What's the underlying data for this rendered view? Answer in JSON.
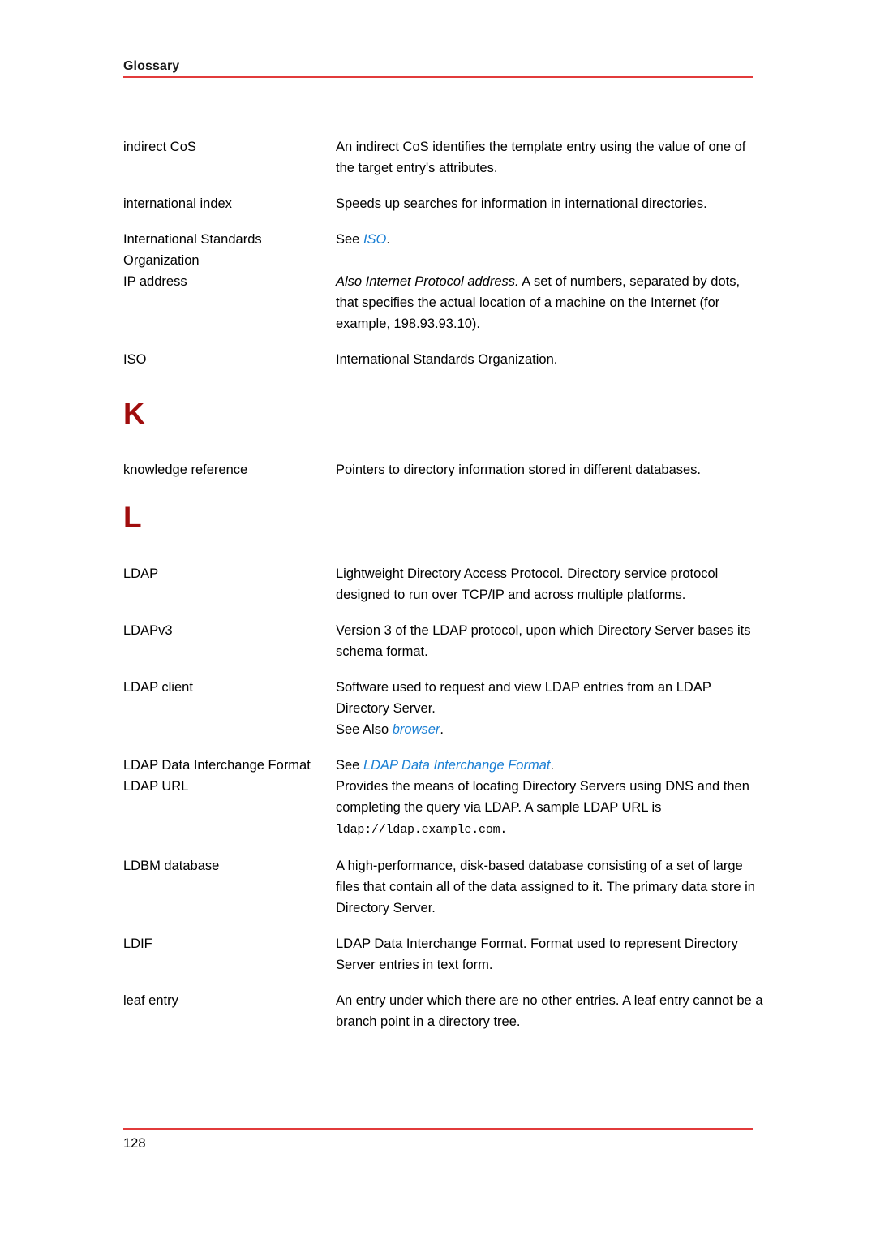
{
  "header": {
    "title": "Glossary",
    "rule_color": "#e23b3b"
  },
  "colors": {
    "link": "#1a7fd4",
    "letter_heading": "#a00d0d",
    "rule": "#e23b3b",
    "text": "#000000"
  },
  "entries": [
    {
      "term": "indirect CoS",
      "definition_plain": "An indirect CoS identifies the template entry using the value of one of the target entry's attributes."
    },
    {
      "term": "international index",
      "definition_plain": "Speeds up searches for information in international directories."
    },
    {
      "term": "International Standards Organization",
      "definition_see_label": "See ",
      "definition_xref": "ISO",
      "definition_tail": "."
    },
    {
      "term": "IP address",
      "definition_italic_lead": "Also Internet Protocol address.",
      "definition_rest": " A set of numbers, separated by dots, that specifies the actual location of a machine on the Internet (for example, 198.93.93.10)."
    },
    {
      "term": "ISO",
      "definition_plain": "International Standards Organization."
    }
  ],
  "letters": {
    "k": "K",
    "l": "L"
  },
  "k_entries": [
    {
      "term": "knowledge reference",
      "definition_plain": "Pointers to directory information stored in different databases."
    }
  ],
  "l_entries": [
    {
      "term": "LDAP",
      "definition_plain": "Lightweight Directory Access Protocol. Directory service protocol designed to run over TCP/IP and across multiple platforms."
    },
    {
      "term": "LDAPv3",
      "definition_plain": "Version 3 of the LDAP protocol, upon which Directory Server bases its schema format."
    },
    {
      "term": "LDAP client",
      "definition_plain": "Software used to request and view LDAP entries from an LDAP Directory Server.",
      "see_also_label": "See Also ",
      "see_also_xref": "browser",
      "see_also_tail": "."
    },
    {
      "term": "LDAP Data Interchange Format",
      "definition_see_label": "See ",
      "definition_xref": "LDAP Data Interchange Format",
      "definition_tail": "."
    },
    {
      "term": "LDAP URL",
      "definition_lead": "Provides the means of locating Directory Servers using DNS and then completing the query via LDAP. A sample LDAP URL is ",
      "definition_mono": "ldap://ldap.example.com.",
      "definition_tail": ""
    },
    {
      "term": "LDBM database",
      "definition_plain": "A high-performance, disk-based database consisting of a set of large files that contain all of the data assigned to it. The primary data store in Directory Server."
    },
    {
      "term": "LDIF",
      "definition_plain": "LDAP Data Interchange Format. Format used to represent Directory Server entries in text form."
    },
    {
      "term": "leaf entry",
      "definition_plain": "An entry under which there are no other entries. A leaf entry cannot be a branch point in a directory tree."
    }
  ],
  "footer": {
    "page_number": "128"
  }
}
